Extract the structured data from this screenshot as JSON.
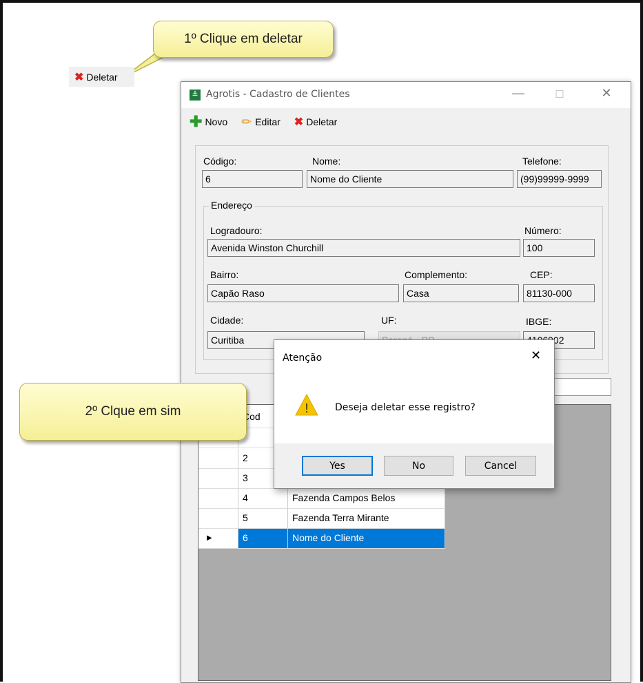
{
  "callouts": {
    "step1": "1º Clique em deletar",
    "step2": "2º Clque em sim"
  },
  "standalone_delete_label": "Deletar",
  "window": {
    "title": "Agrotis - Cadastro de Clientes",
    "controls": {
      "minimize": "—",
      "maximize": "☐",
      "close": "✕"
    }
  },
  "toolbar": {
    "novo": "Novo",
    "editar": "Editar",
    "deletar": "Deletar"
  },
  "form": {
    "codigo_label": "Código:",
    "codigo": "6",
    "nome_label": "Nome:",
    "nome": "Nome do Cliente",
    "telefone_label": "Telefone:",
    "telefone": "(99)99999-9999",
    "endereco_label": "Endereço",
    "logradouro_label": "Logradouro:",
    "logradouro": "Avenida Winston Churchill",
    "numero_label": "Número:",
    "numero": "100",
    "bairro_label": "Bairro:",
    "bairro": "Capão Raso",
    "complemento_label": "Complemento:",
    "complemento": "Casa",
    "cep_label": "CEP:",
    "cep": "81130-000",
    "cidade_label": "Cidade:",
    "cidade": "Curitiba",
    "uf_label": "UF:",
    "uf": "Paraná - PR",
    "ibge_label": "IBGE:",
    "ibge": "4106902"
  },
  "grid": {
    "header_cod": "Cod",
    "rows": [
      {
        "cod": "2",
        "nome": ""
      },
      {
        "cod": "3",
        "nome": ""
      },
      {
        "cod": "4",
        "nome": "Fazenda Campos Belos"
      },
      {
        "cod": "5",
        "nome": "Fazenda Terra Mirante"
      },
      {
        "cod": "6",
        "nome": "Nome do Cliente"
      }
    ],
    "selected_marker": "▶"
  },
  "dialog": {
    "title": "Atenção",
    "close": "✕",
    "warning_icon": "!",
    "message": "Deseja deletar esse registro?",
    "yes": "Yes",
    "no": "No",
    "cancel": "Cancel"
  },
  "colors": {
    "selection": "#0078d7",
    "callout": "#f5ef96",
    "warning": "#f5c400"
  }
}
